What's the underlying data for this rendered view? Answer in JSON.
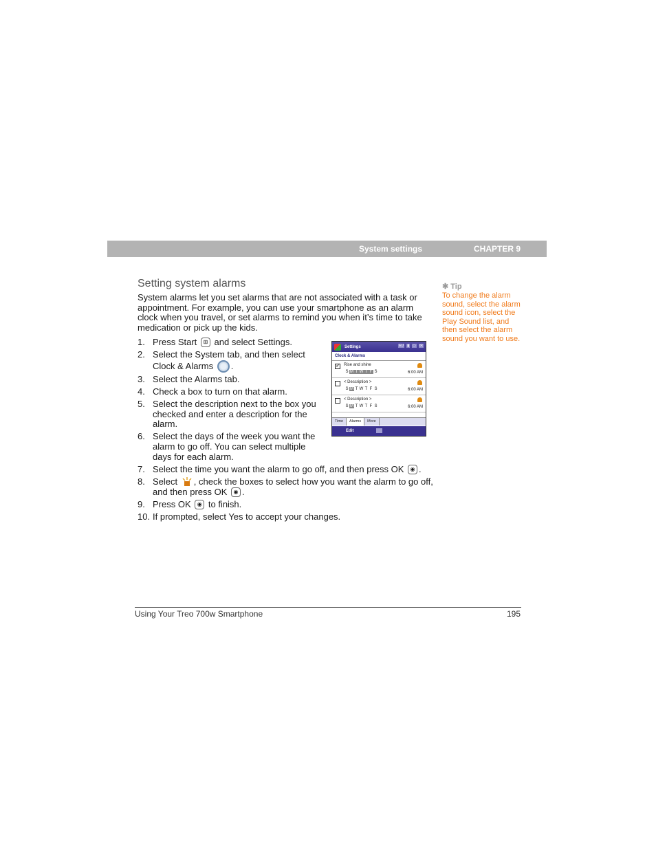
{
  "header": {
    "section": "System settings",
    "chapter": "CHAPTER 9"
  },
  "title": "Setting system alarms",
  "intro": "System alarms let you set alarms that are not associated with a task or appointment. For example, you can use your smartphone as an alarm clock when you travel, or set alarms to remind you when it’s time to take medication or pick up the kids.",
  "steps": [
    {
      "num": "1.",
      "pre": "Press Start",
      "icon": "start-icon",
      "post": " and select Settings."
    },
    {
      "num": "2.",
      "pre": "Select the System tab, and then select Clock & Alarms",
      "icon": "clock-alarms-icon",
      "post": "."
    },
    {
      "num": "3.",
      "text": "Select the Alarms tab."
    },
    {
      "num": "4.",
      "text": "Check a box to turn on that alarm."
    },
    {
      "num": "5.",
      "text": "Select the description next to the box you checked and enter a description for the alarm."
    },
    {
      "num": "6.",
      "text": "Select the days of the week you want the alarm to go off. You can select multiple days for each alarm."
    },
    {
      "num": "7.",
      "pre": "Select the time you want the alarm to go off, and then press OK",
      "icon": "ok-button-icon",
      "post": "."
    },
    {
      "num": "8.",
      "pre": "Select",
      "icon": "alarm-sound-icon",
      "post": ", check the boxes to select how you want the alarm to go off, and then press OK",
      "icon2": "ok-button-icon",
      "post2": "."
    },
    {
      "num": "9.",
      "pre": "Press OK",
      "icon": "ok-button-icon",
      "post": " to finish."
    },
    {
      "num": "10.",
      "text": "If prompted, select Yes to accept your changes."
    }
  ],
  "phone": {
    "title": "Settings",
    "status_items": [
      "EU",
      "signal",
      "battery",
      "ok"
    ],
    "subtitle": "Clock & Alarms",
    "days": [
      "S",
      "M",
      "T",
      "W",
      "T",
      "F",
      "S"
    ],
    "alarms": [
      {
        "checked": true,
        "checkmark": "✔",
        "description": "Rise and shine",
        "active_days": [
          1,
          2,
          3,
          4,
          5
        ],
        "time": "6:00 AM"
      },
      {
        "checked": false,
        "checkmark": "",
        "description": "< Description >",
        "active_days": [
          1
        ],
        "time": "6:00 AM"
      },
      {
        "checked": false,
        "checkmark": "",
        "description": "< Description >",
        "active_days": [
          1
        ],
        "time": "6:00 AM"
      }
    ],
    "tabs": [
      "Time",
      "Alarms",
      "More"
    ],
    "active_tab": "Alarms",
    "menu_left": "Edit"
  },
  "tip": {
    "label": "✱ Tip",
    "text": "To change the alarm sound, select the alarm sound icon, select the Play Sound list, and then select the alarm sound you want to use.",
    "color": "#f07a1a"
  },
  "footer": {
    "book_title": "Using Your Treo 700w Smartphone",
    "page_number": "195"
  }
}
